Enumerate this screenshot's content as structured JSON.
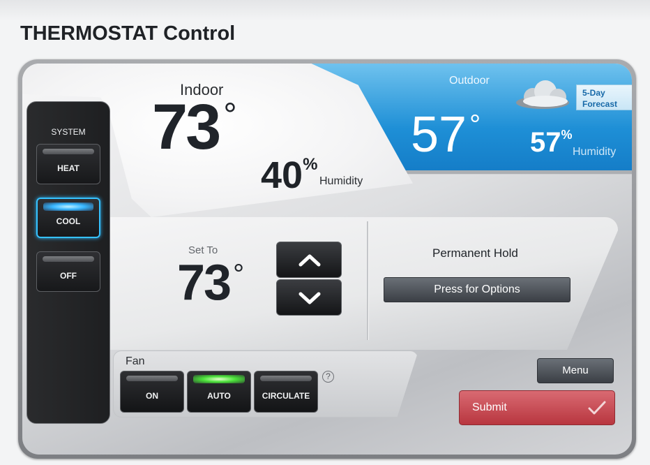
{
  "page": {
    "title": "THERMOSTAT Control"
  },
  "indoor": {
    "label": "Indoor",
    "temperature": "73",
    "degree_symbol": "°",
    "humidity": "40",
    "humidity_unit": "%",
    "humidity_label": "Humidity"
  },
  "outdoor": {
    "label": "Outdoor",
    "temperature": "57",
    "degree_symbol": "°",
    "humidity": "57",
    "humidity_unit": "%",
    "humidity_label": "Humidity",
    "forecast_line1": "5-Day",
    "forecast_line2": "Forecast",
    "weather_icon": "cloud-icon"
  },
  "system": {
    "label": "SYSTEM",
    "buttons": [
      {
        "label": "HEAT",
        "active": false
      },
      {
        "label": "COOL",
        "active": true
      },
      {
        "label": "OFF",
        "active": false
      }
    ],
    "active_color": "#36c2ff"
  },
  "setpoint": {
    "label": "Set To",
    "temperature": "73",
    "degree_symbol": "°",
    "up_icon": "chevron-up-icon",
    "down_icon": "chevron-down-icon"
  },
  "hold": {
    "label": "Permanent Hold",
    "options_button": "Press for Options"
  },
  "fan": {
    "label": "Fan",
    "buttons": [
      {
        "label": "ON",
        "active": false
      },
      {
        "label": "AUTO",
        "active": true
      },
      {
        "label": "CIRCULATE",
        "active": false
      }
    ],
    "help_glyph": "?",
    "active_color": "#4be23a"
  },
  "actions": {
    "menu_label": "Menu",
    "submit_label": "Submit",
    "submit_color": "#c94b54"
  }
}
